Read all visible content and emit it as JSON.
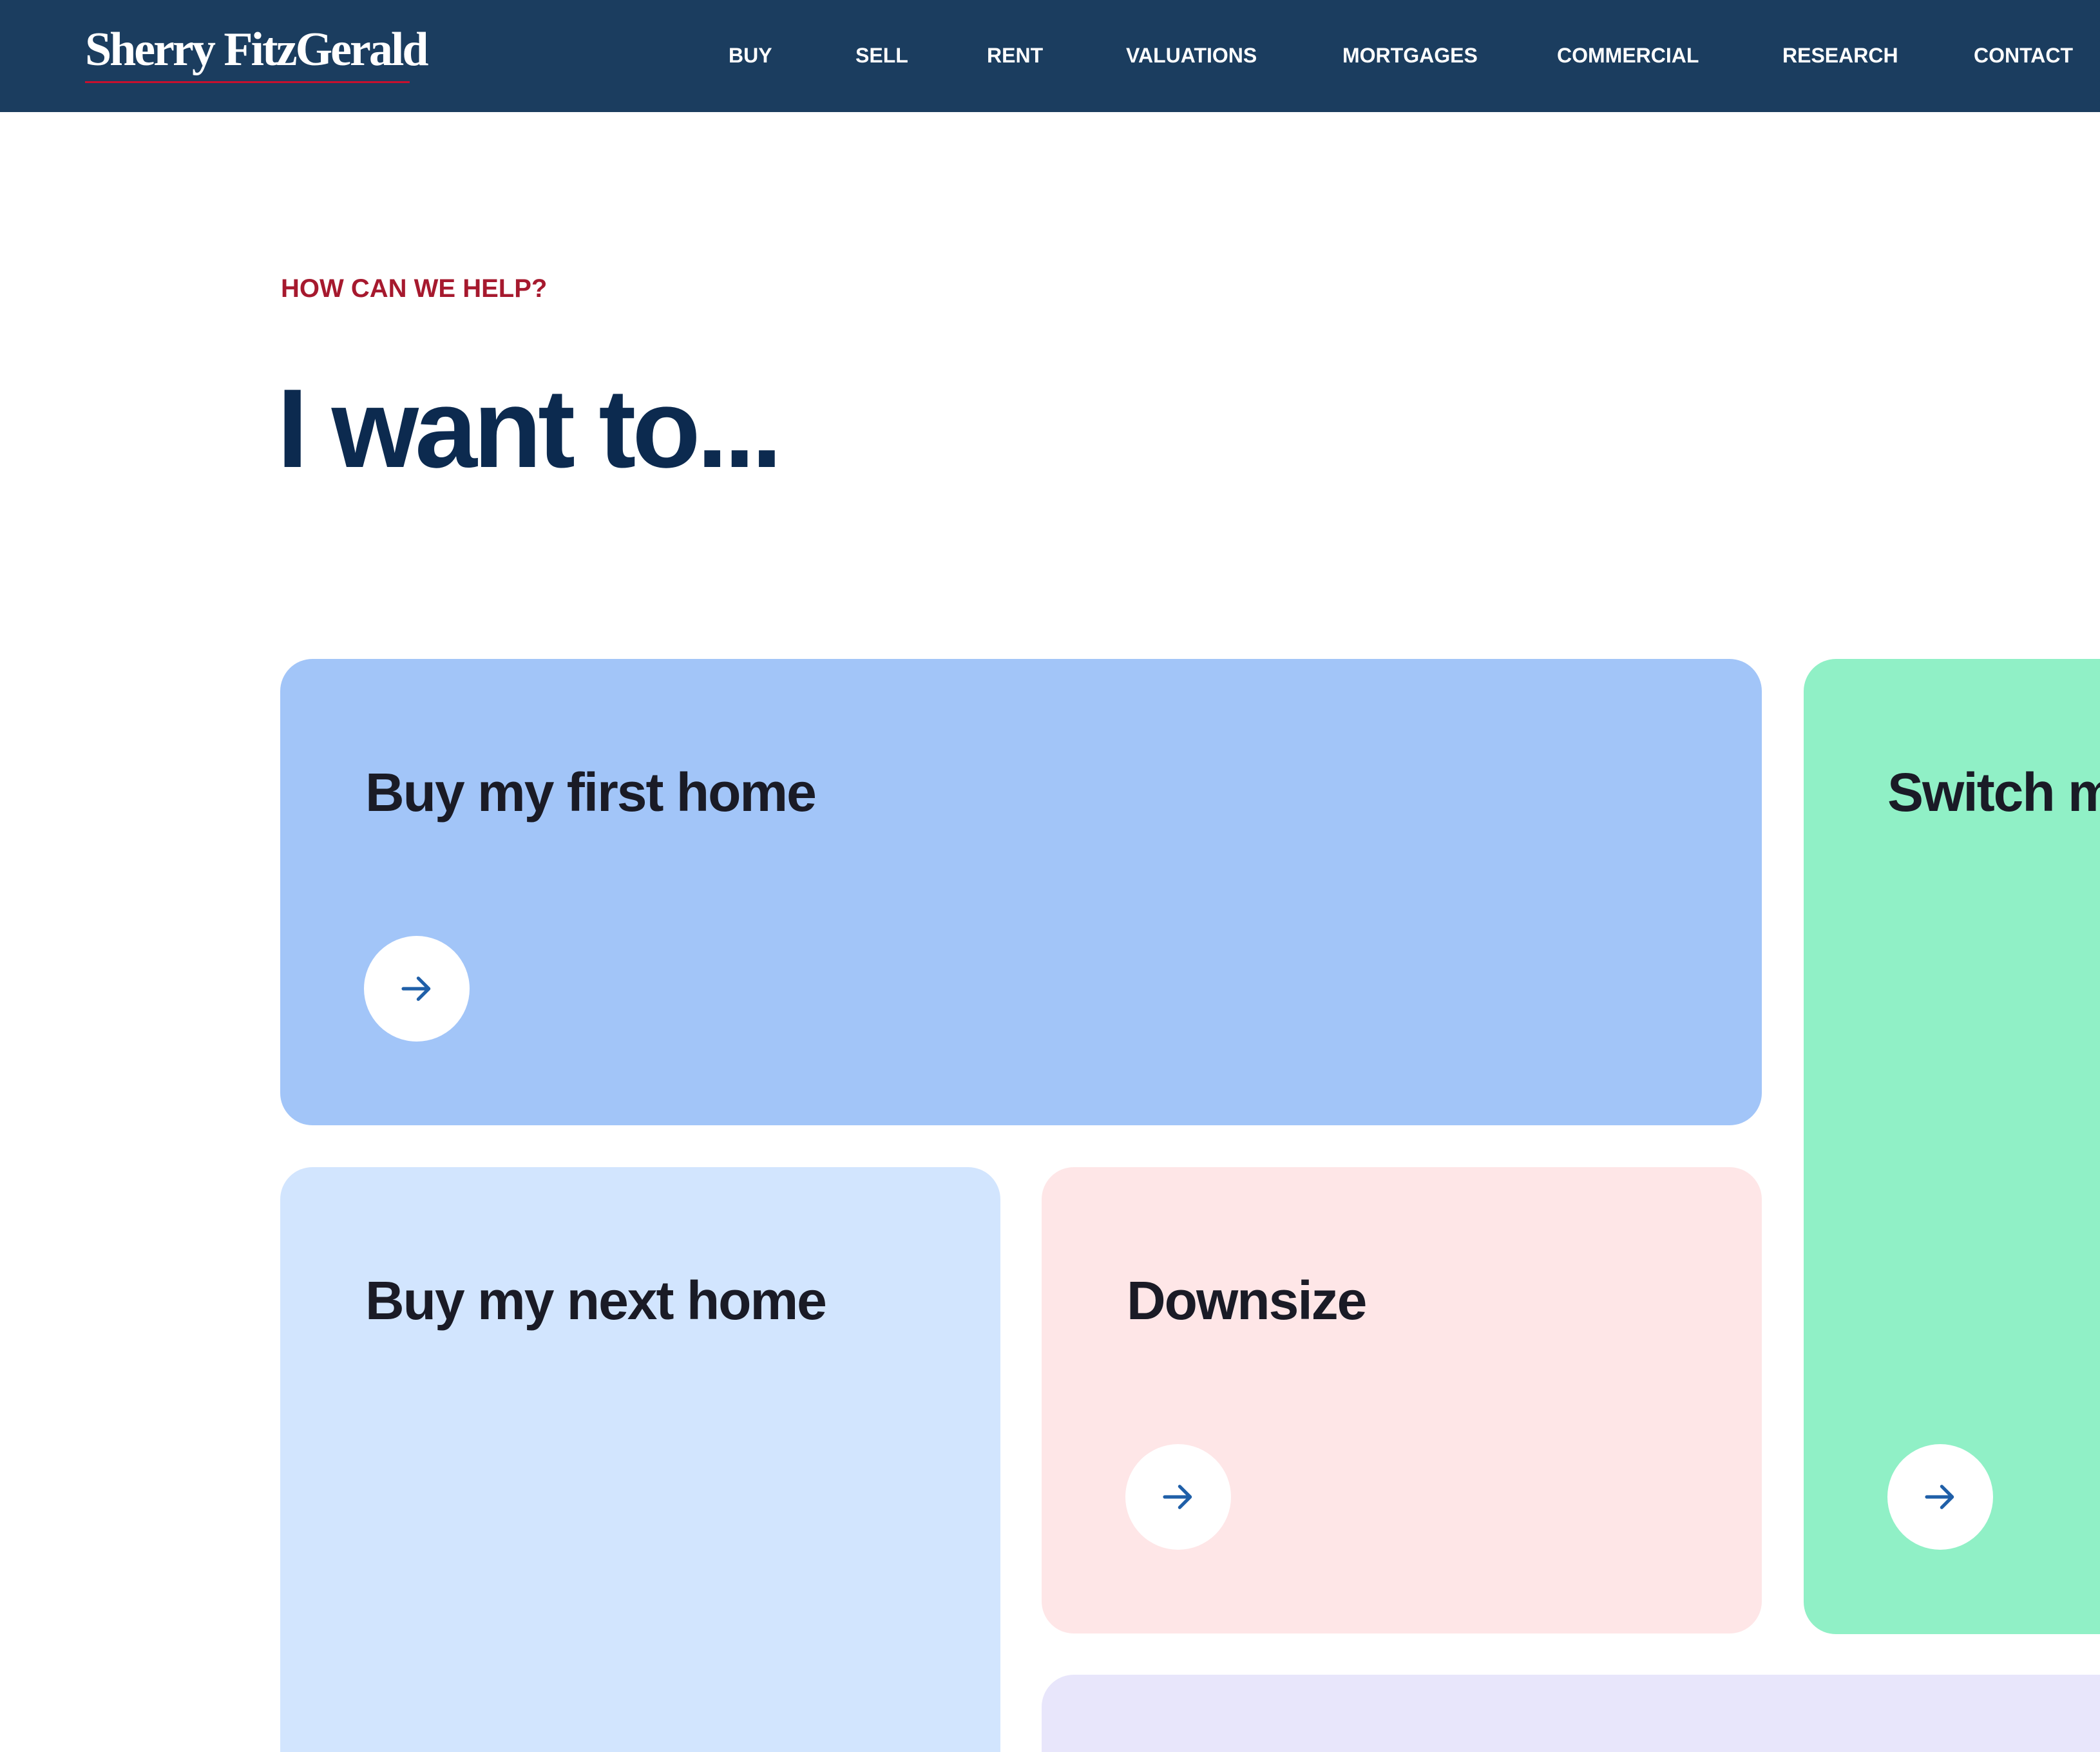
{
  "brand": {
    "logo_text": "Sherry FitzGerald"
  },
  "nav": {
    "items": [
      {
        "label": "BUY"
      },
      {
        "label": "SELL"
      },
      {
        "label": "RENT"
      },
      {
        "label": "VALUATIONS"
      },
      {
        "label": "MORTGAGES"
      },
      {
        "label": "COMMERCIAL"
      },
      {
        "label": "RESEARCH"
      },
      {
        "label": "CONTACT"
      }
    ]
  },
  "intro": {
    "eyebrow": "HOW CAN WE HELP?",
    "heading": "I want to..."
  },
  "cards": [
    {
      "title": "Buy my first home"
    },
    {
      "title": "Switch my mortgage"
    },
    {
      "title": "Buy my next home"
    },
    {
      "title": "Downsize"
    },
    {
      "title": ""
    }
  ],
  "icons": {
    "arrow": "arrow-right-icon"
  },
  "colors": {
    "nav_bg": "#1b3d5f",
    "brand_red": "#a6192e",
    "heading": "#0c2a4f",
    "card_first_home": "#a2c5f8",
    "card_switch": "#90f0c6",
    "card_next_home": "#d2e5fe",
    "card_downsize": "#fee6e7",
    "card_lavender": "#e8e6fb",
    "arrow": "#1f5fa8"
  }
}
